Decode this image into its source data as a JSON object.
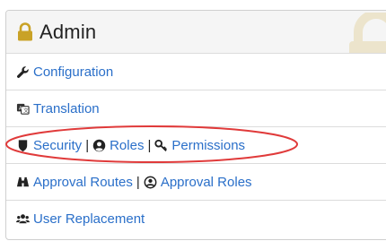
{
  "panel": {
    "title": "Admin",
    "header_icon": "lock-icon",
    "watermark_icon": "lock-icon"
  },
  "menu": {
    "configuration": {
      "label": "Configuration",
      "icon": "wrench-icon"
    },
    "translation": {
      "label": "Translation",
      "icon": "translation-icon"
    },
    "security": {
      "label": "Security",
      "icon": "shield-icon"
    },
    "roles": {
      "label": "Roles",
      "icon": "user-circle-icon"
    },
    "permissions": {
      "label": "Permissions",
      "icon": "key-icon"
    },
    "approval_routes": {
      "label": "Approval Routes",
      "icon": "binoculars-icon"
    },
    "approval_roles": {
      "label": "Approval Roles",
      "icon": "user-circle-outline-icon"
    },
    "user_replacement": {
      "label": "User Replacement",
      "icon": "users-icon"
    },
    "separator": "|"
  },
  "annotation": {
    "highlight_color": "#e03a3a"
  },
  "colors": {
    "link": "#2a6fc9",
    "header_bg": "#f5f5f5",
    "lock_gold": "#c9a227"
  }
}
